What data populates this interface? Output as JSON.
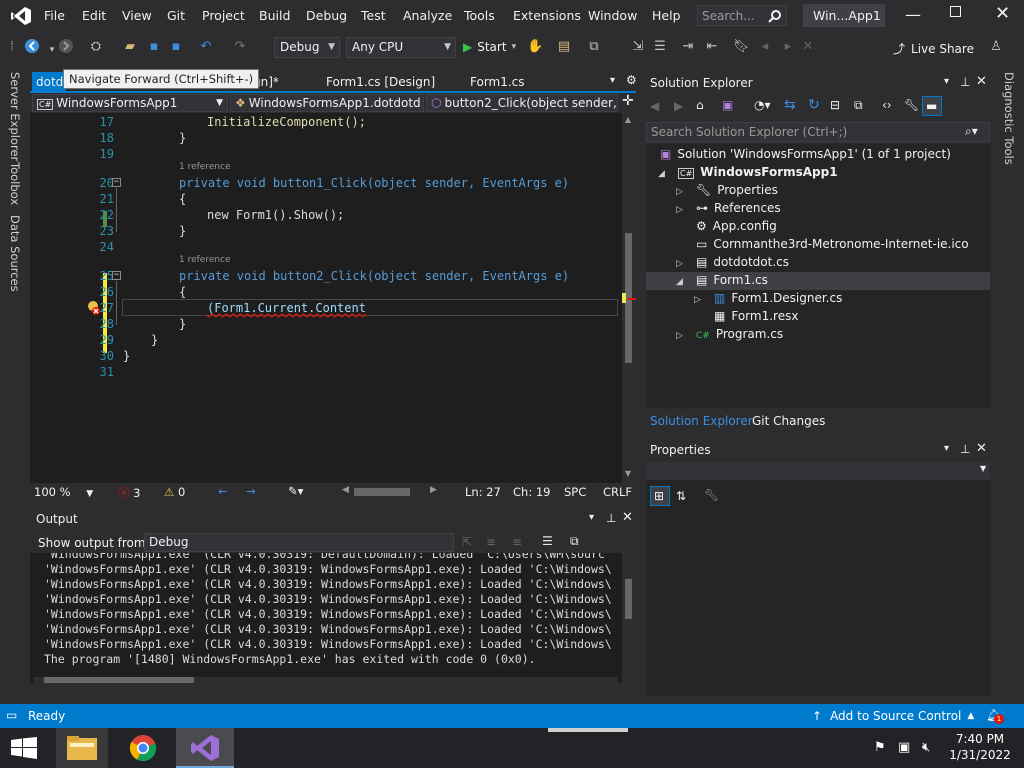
{
  "window": {
    "title": "Win...App1"
  },
  "menu": [
    "File",
    "Edit",
    "View",
    "Git",
    "Project",
    "Build",
    "Debug",
    "Test",
    "Analyze",
    "Tools",
    "Extensions",
    "Window",
    "Help"
  ],
  "search": {
    "placeholder": "Search..."
  },
  "toolbar": {
    "config": "Debug",
    "platform": "Any CPU",
    "start": "Start",
    "live_share": "Live Share"
  },
  "tooltip": "Navigate Forward (Ctrl+Shift+-)",
  "left_strip": [
    "Server Explorer",
    "Toolbox",
    "Data Sources"
  ],
  "right_strip": [
    "Diagnostic Tools"
  ],
  "tabs": [
    {
      "label": "dotd"
    },
    {
      "label": "esign]*"
    },
    {
      "label": "Form1.cs [Design]"
    },
    {
      "label": "Form1.cs"
    }
  ],
  "nav": {
    "project": "WindowsFormsApp1",
    "class": "WindowsFormsApp1.dotdotd",
    "member": "button2_Click(object sender, E"
  },
  "code": {
    "lines": [
      {
        "n": "17",
        "t": "InitializeComponent();"
      },
      {
        "n": "18",
        "t": "}"
      },
      {
        "n": "19",
        "t": ""
      },
      {
        "n": "20",
        "t": "private void button1_Click(object sender, EventArgs e)"
      },
      {
        "n": "21",
        "t": "{"
      },
      {
        "n": "22",
        "t": "new Form1().Show();"
      },
      {
        "n": "23",
        "t": "}"
      },
      {
        "n": "24",
        "t": ""
      },
      {
        "n": "25",
        "t": "private void button2_Click(object sender, EventArgs e)"
      },
      {
        "n": "26",
        "t": "{"
      },
      {
        "n": "27",
        "t": "(Form1.Current.Content"
      },
      {
        "n": "28",
        "t": "}"
      },
      {
        "n": "29",
        "t": "}"
      },
      {
        "n": "30",
        "t": "}"
      },
      {
        "n": "31",
        "t": ""
      }
    ],
    "reference_label": "1 reference"
  },
  "editor_status": {
    "zoom": "100 %",
    "errors": "3",
    "warnings": "0",
    "line": "Ln: 27",
    "col": "Ch: 19",
    "spc": "SPC",
    "eol": "CRLF"
  },
  "output": {
    "title": "Output",
    "show_from_label": "Show output from:",
    "source": "Debug",
    "lines": [
      "'WindowsFormsApp1.exe' (CLR v4.0.30319: DefaultDomain): Loaded 'C:\\Users\\WM\\sourc",
      "'WindowsFormsApp1.exe' (CLR v4.0.30319: WindowsFormsApp1.exe): Loaded 'C:\\Windows\\",
      "'WindowsFormsApp1.exe' (CLR v4.0.30319: WindowsFormsApp1.exe): Loaded 'C:\\Windows\\",
      "'WindowsFormsApp1.exe' (CLR v4.0.30319: WindowsFormsApp1.exe): Loaded 'C:\\Windows\\",
      "'WindowsFormsApp1.exe' (CLR v4.0.30319: WindowsFormsApp1.exe): Loaded 'C:\\Windows\\",
      "'WindowsFormsApp1.exe' (CLR v4.0.30319: WindowsFormsApp1.exe): Loaded 'C:\\Windows\\",
      "'WindowsFormsApp1.exe' (CLR v4.0.30319: WindowsFormsApp1.exe): Loaded 'C:\\Windows\\",
      "The program '[1480] WindowsFormsApp1.exe' has exited with code 0 (0x0)."
    ]
  },
  "solution_explorer": {
    "title": "Solution Explorer",
    "search_placeholder": "Search Solution Explorer (Ctrl+;)",
    "nodes": [
      {
        "label": "Solution 'WindowsFormsApp1' (1 of 1 project)"
      },
      {
        "label": "WindowsFormsApp1"
      },
      {
        "label": "Properties"
      },
      {
        "label": "References"
      },
      {
        "label": "App.config"
      },
      {
        "label": "Cornmanthe3rd-Metronome-Internet-ie.ico"
      },
      {
        "label": "dotdotdot.cs"
      },
      {
        "label": "Form1.cs"
      },
      {
        "label": "Form1.Designer.cs"
      },
      {
        "label": "Form1.resx"
      },
      {
        "label": "Program.cs"
      }
    ],
    "bottom_tabs": [
      "Solution Explorer",
      "Git Changes"
    ]
  },
  "properties": {
    "title": "Properties"
  },
  "statusbar": {
    "ready": "Ready",
    "source_control": "Add to Source Control"
  },
  "taskbar": {
    "time": "7:40 PM",
    "date": "1/31/2022"
  },
  "colors": {
    "accent": "#007acc",
    "background": "#2d2d30",
    "editor": "#1e1e1e",
    "selection": "#3f3f46"
  }
}
